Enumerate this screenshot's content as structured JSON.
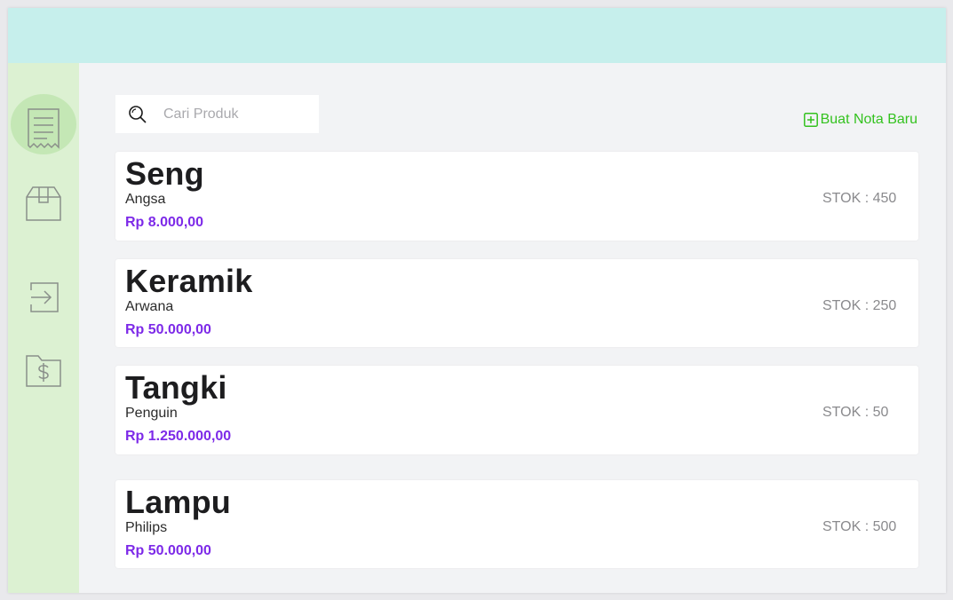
{
  "search": {
    "placeholder": "Cari Produk"
  },
  "actions": {
    "new_note_label": "Buat Nota Baru"
  },
  "sidebar": {
    "items": [
      {
        "icon": "receipt-icon",
        "active": true
      },
      {
        "icon": "box-icon",
        "active": false
      },
      {
        "icon": "login-icon",
        "active": false
      },
      {
        "icon": "money-folder-icon",
        "active": false
      }
    ]
  },
  "products": [
    {
      "name": "Seng",
      "brand": "Angsa",
      "price": "Rp 8.000,00",
      "stock": "STOK : 450"
    },
    {
      "name": "Keramik",
      "brand": "Arwana",
      "price": "Rp 50.000,00",
      "stock": "STOK : 250"
    },
    {
      "name": "Tangki",
      "brand": "Penguin",
      "price": "Rp 1.250.000,00",
      "stock": "STOK : 50"
    },
    {
      "name": "Lampu",
      "brand": "Philips",
      "price": "Rp 50.000,00",
      "stock": "STOK : 500"
    }
  ],
  "colors": {
    "header": "#c6efec",
    "sidebar": "#dcf1d2",
    "accent_green": "#34c21f",
    "price_purple": "#7d2ae8"
  }
}
